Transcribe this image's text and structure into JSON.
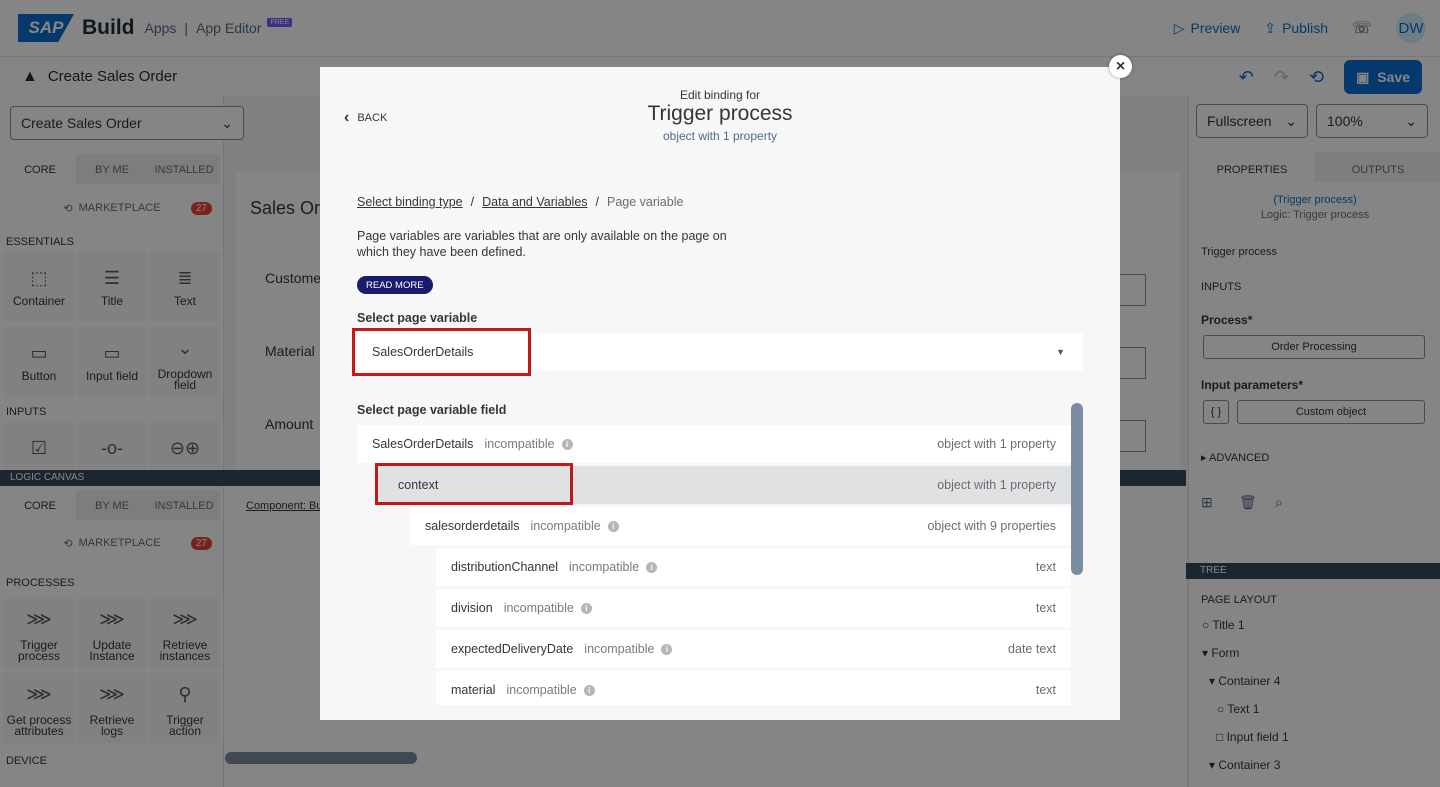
{
  "app": {
    "brand": "Build",
    "apps": "Apps",
    "sep": "|",
    "editor": "App Editor",
    "free": "FREE",
    "preview": "Preview",
    "publish": "Publish",
    "avatar": "DW",
    "page_name": "Create Sales Order",
    "save": "Save"
  },
  "left": {
    "page_select": "Create Sales Order",
    "tabs": [
      "CORE",
      "BY ME",
      "INSTALLED"
    ],
    "marketplace": "MARKETPLACE",
    "marketplace_count": "27",
    "essentials": "ESSENTIALS",
    "inputs": "INPUTS",
    "tiles": [
      "Container",
      "Title",
      "Text",
      "Button",
      "Input field",
      "Dropdown field"
    ],
    "logic_canvas": "LOGIC CANVAS",
    "processes": "PROCESSES",
    "process_tiles": [
      "Trigger process",
      "Update Instance",
      "Retrieve instances",
      "Get process attributes",
      "Retrieve logs",
      "Trigger action"
    ],
    "device": "DEVICE"
  },
  "canvas": {
    "title": "Sales Orc",
    "labels": [
      "Customer",
      "Material",
      "Amount"
    ],
    "component_link": "Component: Bu"
  },
  "right": {
    "view_select": "Fullscreen",
    "zoom_select": "100%",
    "tabs": [
      "PROPERTIES",
      "OUTPUTS"
    ],
    "link_title": "(Trigger process)",
    "logic_caption": "Logic: Trigger process",
    "component_name": "Trigger process",
    "inputs": "INPUTS",
    "process_label": "Process*",
    "process_value": "Order Processing",
    "input_params_label": "Input parameters*",
    "input_params_value": "Custom object",
    "advanced": "ADVANCED",
    "tree": "TREE",
    "page_layout": "PAGE LAYOUT",
    "tree_items": [
      "Title 1",
      "Form",
      "Container 4",
      "Text 1",
      "Input field 1",
      "Container 3"
    ]
  },
  "dialog": {
    "back": "BACK",
    "heading_small": "Edit binding for",
    "heading": "Trigger process",
    "subheading": "object with 1 property",
    "breadcrumb": {
      "step1": "Select binding type",
      "step2": "Data and Variables",
      "current": "Page variable",
      "sep": "/"
    },
    "description": "Page variables are variables that are only available on the page on which they have been defined.",
    "read_more": "READ MORE",
    "select_var_label": "Select page variable",
    "selected_var": "SalesOrderDetails",
    "select_field_label": "Select page variable field",
    "fields": [
      {
        "name": "SalesOrderDetails",
        "status": "incompatible",
        "type": "object with 1 property",
        "level": 0,
        "selected": false
      },
      {
        "name": "context",
        "status": "",
        "type": "object with 1 property",
        "level": 1,
        "selected": true
      },
      {
        "name": "salesorderdetails",
        "status": "incompatible",
        "type": "object with 9 properties",
        "level": 2,
        "selected": false
      },
      {
        "name": "distributionChannel",
        "status": "incompatible",
        "type": "text",
        "level": 3,
        "selected": false
      },
      {
        "name": "division",
        "status": "incompatible",
        "type": "text",
        "level": 3,
        "selected": false
      },
      {
        "name": "expectedDeliveryDate",
        "status": "incompatible",
        "type": "date text",
        "level": 3,
        "selected": false
      },
      {
        "name": "material",
        "status": "incompatible",
        "type": "text",
        "level": 3,
        "selected": false
      }
    ]
  }
}
